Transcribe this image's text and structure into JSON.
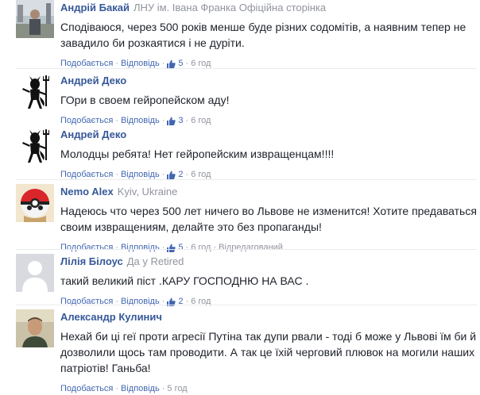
{
  "actions": {
    "like_label": "Подобається",
    "reply_label": "Відповідь",
    "separator": "·"
  },
  "comments": [
    {
      "author": "Андрій Бакай",
      "affiliation": "ЛНУ ім. Івана Франка Офіційна сторінка",
      "text": "Сподіваюся, через 500 років менше буде різних содомітів, а наявним тепер не завадило би розкаятися і не дуріти.",
      "likes": "5",
      "time": "6 год",
      "extra": "",
      "avatar": "photo-man-outdoors"
    },
    {
      "author": "Андрей Деко",
      "affiliation": "",
      "text": "ГОри в своем гейропейском аду!",
      "likes": "3",
      "time": "6 год",
      "extra": "",
      "avatar": "devil-trident-silhouette"
    },
    {
      "author": "Андрей Деко",
      "affiliation": "",
      "text": "Молодцы ребята! Нет гейропейским извращенцам!!!!",
      "likes": "2",
      "time": "6 год",
      "extra": "",
      "avatar": "devil-trident-silhouette"
    },
    {
      "author": "Nemo Alex",
      "affiliation": "Kyiv, Ukraine",
      "text": "Надеюсь что через 500 лет ничего во Львове не изменится! Хотите предаваться своим извращениям, делайте это без пропаганды!",
      "likes": "5",
      "time": "6 год",
      "extra": "Відредагований",
      "avatar": "pokeball-cartoon"
    },
    {
      "author": "Лілія Білоус",
      "affiliation": "Да у Retired",
      "text": "такий великий піст .КАРУ ГОСПОДНЮ НА ВАС .",
      "likes": "2",
      "time": "6 год",
      "extra": "",
      "avatar": "default-silhouette"
    },
    {
      "author": "Александр Кулинич",
      "affiliation": "",
      "text": "Нехай би ці геї проти агресії Путіна так дупи рвали - тоді б може у Львові їм би й дозволили щось там проводити. А так це їхій черговий плювок на могили наших патріотів! Ганьба!",
      "likes": "",
      "time": "5 год",
      "extra": "",
      "avatar": "photo-man-portrait"
    }
  ],
  "colors": {
    "author": "#365899",
    "link": "#4267b2",
    "meta": "#90949c",
    "text": "#1d2129"
  }
}
